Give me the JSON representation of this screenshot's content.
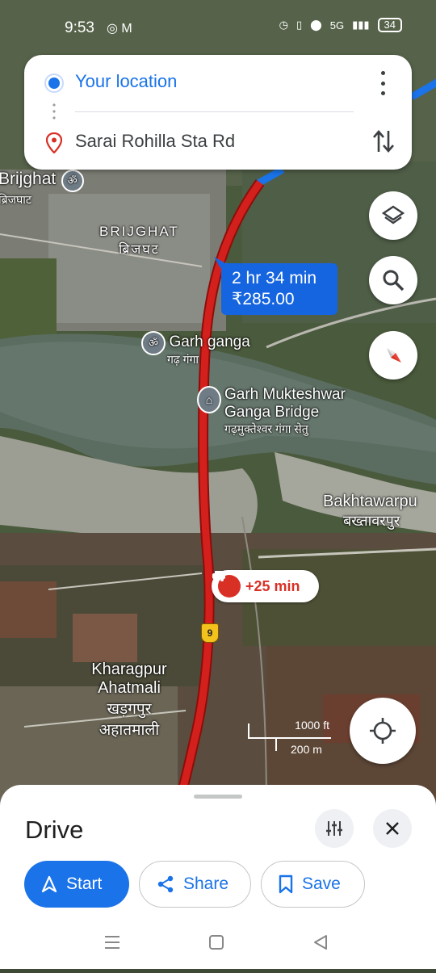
{
  "status_bar": {
    "time": "9:53",
    "icons_left": "◎ M",
    "network": "5G",
    "battery": "34"
  },
  "directions": {
    "origin": "Your location",
    "destination": "Sarai Rohilla Sta Rd"
  },
  "route": {
    "duration": "2 hr 34 min",
    "toll": "₹285.00",
    "delay": "+25 min"
  },
  "places": {
    "brijghat_top": {
      "en": "Brijghat",
      "hi": "ब्रिजघाट"
    },
    "brijghat": {
      "en": "BRIJGHAT",
      "hi": "ब्रिजघट"
    },
    "garh_ganga": {
      "en": "Garh ganga",
      "hi": "गढ़ गंगा"
    },
    "bridge": {
      "en1": "Garh Mukteshwar",
      "en2": "Ganga Bridge",
      "hi": "गढ़मुक्तेश्वर गंगा सेतु"
    },
    "bakhtawarpur": {
      "en": "Bakhtawarpu",
      "hi": "बख्तावरपुर"
    },
    "kharagpur": {
      "en1": "Kharagpur",
      "en2": "Ahatmali",
      "hi1": "खड़गपुर",
      "hi2": "अहातमाली"
    },
    "highway_shield": "9"
  },
  "scale": {
    "imperial": "1000 ft",
    "metric": "200 m"
  },
  "sheet": {
    "mode_title": "Drive",
    "start_label": "Start",
    "share_label": "Share",
    "save_label": "Save"
  },
  "icons": [
    "layers-icon",
    "search-icon",
    "compass-icon",
    "my-location-icon",
    "route-options-icon",
    "close-icon",
    "navigation-arrow-icon",
    "share-icon",
    "bookmark-icon",
    "more-vert-icon",
    "swap-icon",
    "pin-icon"
  ],
  "colors": {
    "route": "#d3201c",
    "accent": "#1a73e8",
    "bubble": "#1565e0",
    "delay": "#d93025"
  }
}
